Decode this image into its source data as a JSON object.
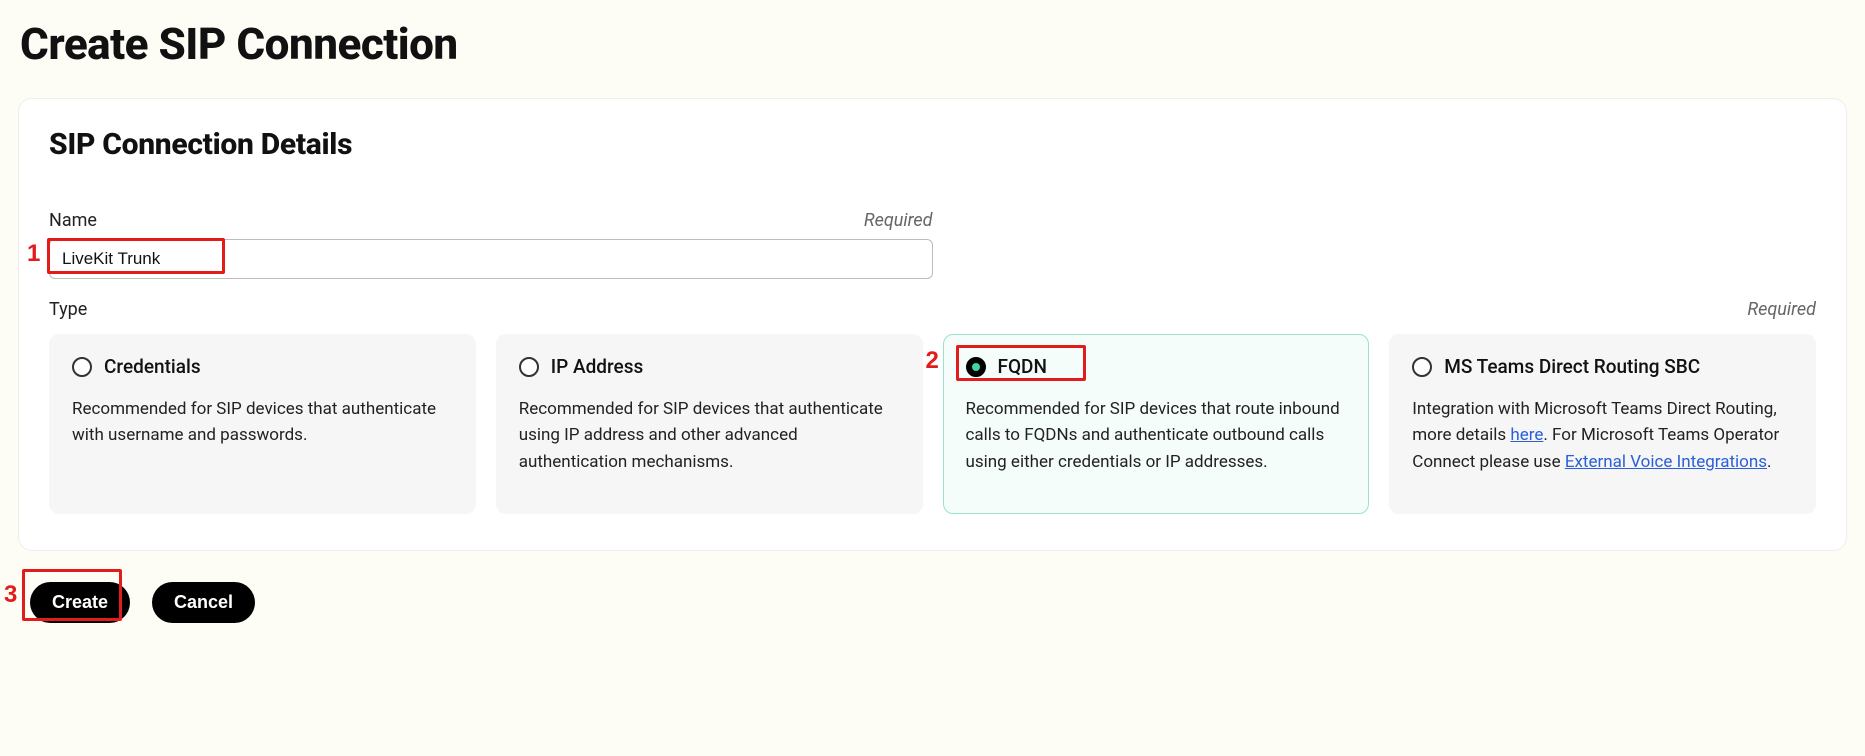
{
  "page": {
    "title": "Create SIP Connection"
  },
  "section": {
    "title": "SIP Connection Details"
  },
  "name_field": {
    "label": "Name",
    "required_text": "Required",
    "value": "LiveKit Trunk"
  },
  "type_field": {
    "label": "Type",
    "required_text": "Required",
    "options": [
      {
        "title": "Credentials",
        "desc": "Recommended for SIP devices that authenticate with username and passwords.",
        "selected": false
      },
      {
        "title": "IP Address",
        "desc": "Recommended for SIP devices that authenticate using IP address and other advanced authentication mechanisms.",
        "selected": false
      },
      {
        "title": "FQDN",
        "desc": "Recommended for SIP devices that route inbound calls to FQDNs and authenticate outbound calls using either credentials or IP addresses.",
        "selected": true
      },
      {
        "title": "MS Teams Direct Routing SBC",
        "desc_pre": "Integration with Microsoft Teams Direct Routing, more details ",
        "link1": "here",
        "desc_mid": ". For Microsoft Teams Operator Connect please use ",
        "link2": "External Voice Integrations",
        "desc_post": ".",
        "selected": false
      }
    ]
  },
  "actions": {
    "create_label": "Create",
    "cancel_label": "Cancel"
  },
  "annotations": {
    "n1": "1",
    "n2": "2",
    "n3": "3"
  }
}
